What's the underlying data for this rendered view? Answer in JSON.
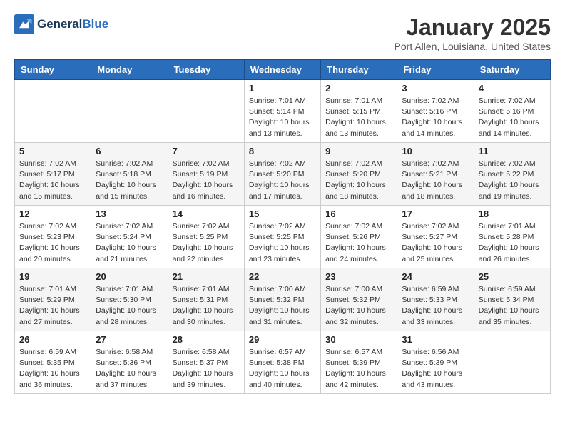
{
  "header": {
    "logo_line1": "General",
    "logo_line2": "Blue",
    "month_title": "January 2025",
    "location": "Port Allen, Louisiana, United States"
  },
  "weekdays": [
    "Sunday",
    "Monday",
    "Tuesday",
    "Wednesday",
    "Thursday",
    "Friday",
    "Saturday"
  ],
  "weeks": [
    [
      {
        "day": "",
        "info": ""
      },
      {
        "day": "",
        "info": ""
      },
      {
        "day": "",
        "info": ""
      },
      {
        "day": "1",
        "info": "Sunrise: 7:01 AM\nSunset: 5:14 PM\nDaylight: 10 hours\nand 13 minutes."
      },
      {
        "day": "2",
        "info": "Sunrise: 7:01 AM\nSunset: 5:15 PM\nDaylight: 10 hours\nand 13 minutes."
      },
      {
        "day": "3",
        "info": "Sunrise: 7:02 AM\nSunset: 5:16 PM\nDaylight: 10 hours\nand 14 minutes."
      },
      {
        "day": "4",
        "info": "Sunrise: 7:02 AM\nSunset: 5:16 PM\nDaylight: 10 hours\nand 14 minutes."
      }
    ],
    [
      {
        "day": "5",
        "info": "Sunrise: 7:02 AM\nSunset: 5:17 PM\nDaylight: 10 hours\nand 15 minutes."
      },
      {
        "day": "6",
        "info": "Sunrise: 7:02 AM\nSunset: 5:18 PM\nDaylight: 10 hours\nand 15 minutes."
      },
      {
        "day": "7",
        "info": "Sunrise: 7:02 AM\nSunset: 5:19 PM\nDaylight: 10 hours\nand 16 minutes."
      },
      {
        "day": "8",
        "info": "Sunrise: 7:02 AM\nSunset: 5:20 PM\nDaylight: 10 hours\nand 17 minutes."
      },
      {
        "day": "9",
        "info": "Sunrise: 7:02 AM\nSunset: 5:20 PM\nDaylight: 10 hours\nand 18 minutes."
      },
      {
        "day": "10",
        "info": "Sunrise: 7:02 AM\nSunset: 5:21 PM\nDaylight: 10 hours\nand 18 minutes."
      },
      {
        "day": "11",
        "info": "Sunrise: 7:02 AM\nSunset: 5:22 PM\nDaylight: 10 hours\nand 19 minutes."
      }
    ],
    [
      {
        "day": "12",
        "info": "Sunrise: 7:02 AM\nSunset: 5:23 PM\nDaylight: 10 hours\nand 20 minutes."
      },
      {
        "day": "13",
        "info": "Sunrise: 7:02 AM\nSunset: 5:24 PM\nDaylight: 10 hours\nand 21 minutes."
      },
      {
        "day": "14",
        "info": "Sunrise: 7:02 AM\nSunset: 5:25 PM\nDaylight: 10 hours\nand 22 minutes."
      },
      {
        "day": "15",
        "info": "Sunrise: 7:02 AM\nSunset: 5:25 PM\nDaylight: 10 hours\nand 23 minutes."
      },
      {
        "day": "16",
        "info": "Sunrise: 7:02 AM\nSunset: 5:26 PM\nDaylight: 10 hours\nand 24 minutes."
      },
      {
        "day": "17",
        "info": "Sunrise: 7:02 AM\nSunset: 5:27 PM\nDaylight: 10 hours\nand 25 minutes."
      },
      {
        "day": "18",
        "info": "Sunrise: 7:01 AM\nSunset: 5:28 PM\nDaylight: 10 hours\nand 26 minutes."
      }
    ],
    [
      {
        "day": "19",
        "info": "Sunrise: 7:01 AM\nSunset: 5:29 PM\nDaylight: 10 hours\nand 27 minutes."
      },
      {
        "day": "20",
        "info": "Sunrise: 7:01 AM\nSunset: 5:30 PM\nDaylight: 10 hours\nand 28 minutes."
      },
      {
        "day": "21",
        "info": "Sunrise: 7:01 AM\nSunset: 5:31 PM\nDaylight: 10 hours\nand 30 minutes."
      },
      {
        "day": "22",
        "info": "Sunrise: 7:00 AM\nSunset: 5:32 PM\nDaylight: 10 hours\nand 31 minutes."
      },
      {
        "day": "23",
        "info": "Sunrise: 7:00 AM\nSunset: 5:32 PM\nDaylight: 10 hours\nand 32 minutes."
      },
      {
        "day": "24",
        "info": "Sunrise: 6:59 AM\nSunset: 5:33 PM\nDaylight: 10 hours\nand 33 minutes."
      },
      {
        "day": "25",
        "info": "Sunrise: 6:59 AM\nSunset: 5:34 PM\nDaylight: 10 hours\nand 35 minutes."
      }
    ],
    [
      {
        "day": "26",
        "info": "Sunrise: 6:59 AM\nSunset: 5:35 PM\nDaylight: 10 hours\nand 36 minutes."
      },
      {
        "day": "27",
        "info": "Sunrise: 6:58 AM\nSunset: 5:36 PM\nDaylight: 10 hours\nand 37 minutes."
      },
      {
        "day": "28",
        "info": "Sunrise: 6:58 AM\nSunset: 5:37 PM\nDaylight: 10 hours\nand 39 minutes."
      },
      {
        "day": "29",
        "info": "Sunrise: 6:57 AM\nSunset: 5:38 PM\nDaylight: 10 hours\nand 40 minutes."
      },
      {
        "day": "30",
        "info": "Sunrise: 6:57 AM\nSunset: 5:39 PM\nDaylight: 10 hours\nand 42 minutes."
      },
      {
        "day": "31",
        "info": "Sunrise: 6:56 AM\nSunset: 5:39 PM\nDaylight: 10 hours\nand 43 minutes."
      },
      {
        "day": "",
        "info": ""
      }
    ]
  ]
}
